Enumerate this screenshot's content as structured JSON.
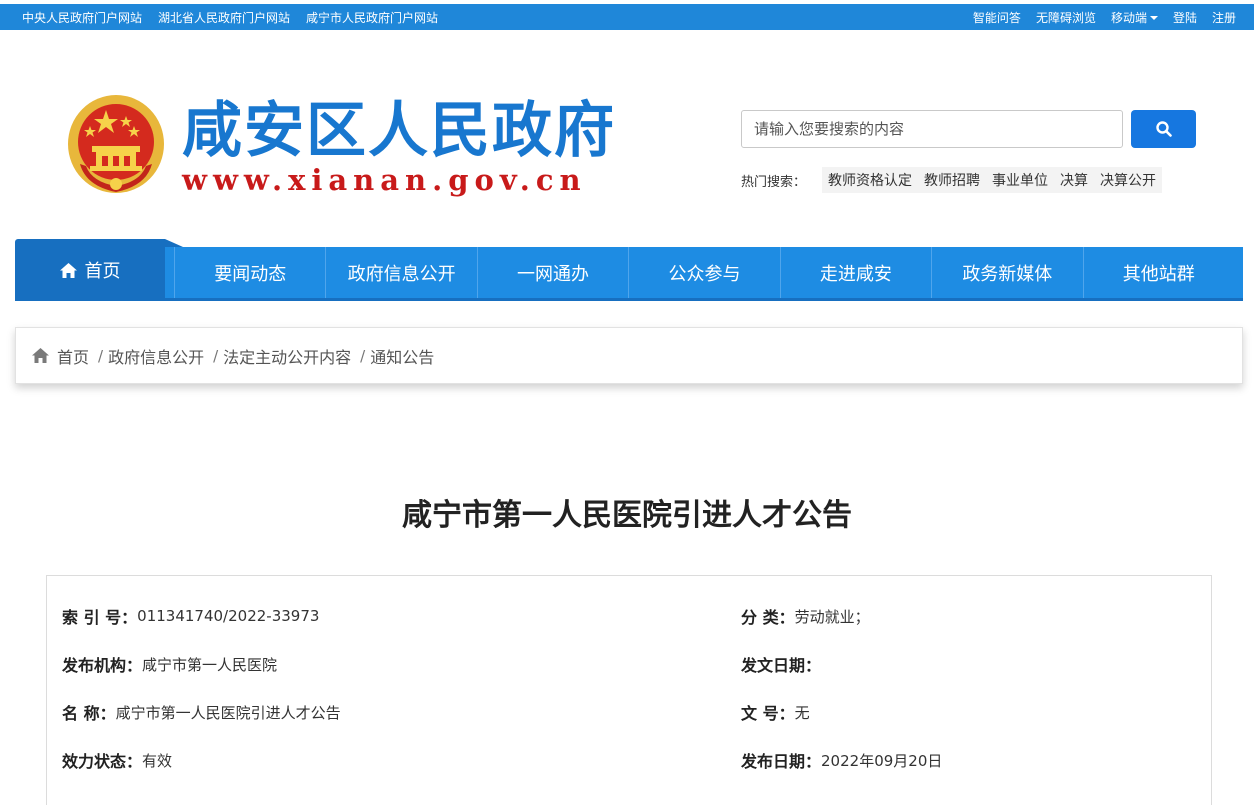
{
  "topbar": {
    "left_links": [
      "中央人民政府门户网站",
      "湖北省人民政府门户网站",
      "咸宁市人民政府门户网站"
    ],
    "right_links": [
      "智能问答",
      "无障碍浏览",
      "移动端",
      "登陆",
      "注册"
    ]
  },
  "header": {
    "site_title": "咸安区人民政府",
    "site_url": "www.xianan.gov.cn",
    "search_placeholder": "请输入您要搜索的内容",
    "hot_label": "热门搜索：",
    "hot_tags": [
      "教师资格认定",
      "教师招聘",
      "事业单位",
      "决算",
      "决算公开"
    ]
  },
  "nav": {
    "home": "首页",
    "items": [
      "要闻动态",
      "政府信息公开",
      "一网通办",
      "公众参与",
      "走进咸安",
      "政务新媒体",
      "其他站群"
    ]
  },
  "breadcrumb": {
    "items": [
      "首页",
      "政府信息公开",
      "法定主动公开内容",
      "通知公告"
    ],
    "separator": "/"
  },
  "article": {
    "title": "咸宁市第一人民医院引进人才公告",
    "meta": {
      "index_label": "索 引 号：",
      "index_value": "011341740/2022-33973",
      "category_label": "分 类：",
      "category_value": "劳动就业；",
      "publisher_label": "发布机构：",
      "publisher_value": "咸宁市第一人民医院",
      "issue_date_label": "发文日期：",
      "issue_date_value": "",
      "name_label": "名 称：",
      "name_value": "咸宁市第一人民医院引进人才公告",
      "doc_no_label": "文 号：",
      "doc_no_value": "无",
      "status_label": "效力状态：",
      "status_value": "有效",
      "publish_date_label": "发布日期：",
      "publish_date_value": "2022年09月20日"
    }
  },
  "colors": {
    "brand_blue": "#1f87d9",
    "nav_dark": "#176fc0",
    "title_blue": "#1877cf",
    "url_red": "#c81a1a"
  },
  "icons": [
    "national-emblem-icon",
    "search-icon",
    "home-icon",
    "breadcrumb-home-icon",
    "caret-down-icon"
  ]
}
